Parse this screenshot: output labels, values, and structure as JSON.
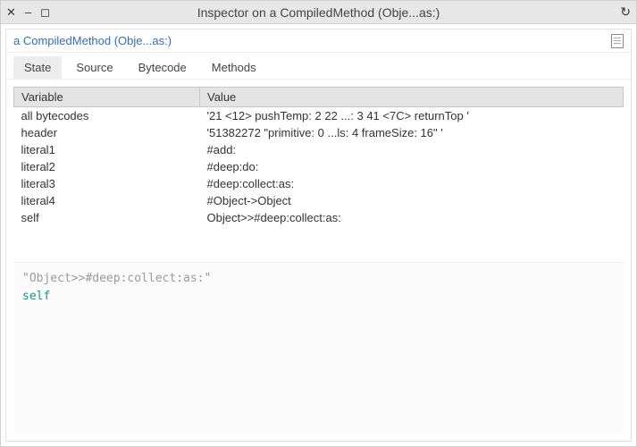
{
  "window": {
    "title": "Inspector on a CompiledMethod (Obje...as:)"
  },
  "breadcrumb": {
    "label": "a CompiledMethod (Obje...as:)"
  },
  "tabs": [
    {
      "label": "State",
      "active": true
    },
    {
      "label": "Source",
      "active": false
    },
    {
      "label": "Bytecode",
      "active": false
    },
    {
      "label": "Methods",
      "active": false
    }
  ],
  "table": {
    "headers": {
      "variable": "Variable",
      "value": "Value"
    },
    "rows": [
      {
        "variable": "all bytecodes",
        "value": "'21 <12> pushTemp: 2 22 ...: 3 41 <7C> returnTop '"
      },
      {
        "variable": "header",
        "value": "'51382272 \"primitive: 0 ...ls: 4  frameSize: 16\" '"
      },
      {
        "variable": "literal1",
        "value": "#add:"
      },
      {
        "variable": "literal2",
        "value": "#deep:do:"
      },
      {
        "variable": "literal3",
        "value": "#deep:collect:as:"
      },
      {
        "variable": "literal4",
        "value": "#Object->Object"
      },
      {
        "variable": "self",
        "value": "Object>>#deep:collect:as:"
      }
    ]
  },
  "code": {
    "comment": "\"Object>>#deep:collect:as:\"",
    "expr": "self"
  }
}
